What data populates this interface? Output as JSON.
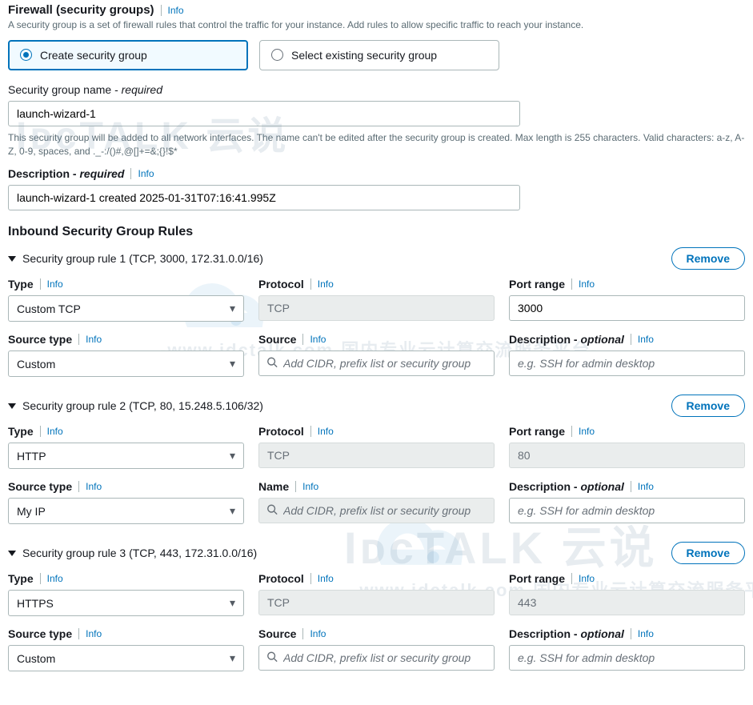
{
  "info_label": "Info",
  "firewall": {
    "title": "Firewall (security groups)",
    "subtext": "A security group is a set of firewall rules that control the traffic for your instance. Add rules to allow specific traffic to reach your instance.",
    "radio_create": "Create security group",
    "radio_select": "Select existing security group"
  },
  "sg_name": {
    "label": "Security group name - ",
    "req": "required",
    "value": "launch-wizard-1",
    "helper": "This security group will be added to all network interfaces. The name can't be edited after the security group is created. Max length is 255 characters. Valid characters: a-z, A-Z, 0-9, spaces, and ._-:/()#,@[]+=&;{}!$*"
  },
  "desc": {
    "label": "Description - ",
    "req": "required",
    "value": "launch-wizard-1 created 2025-01-31T07:16:41.995Z"
  },
  "inbound_heading": "Inbound Security Group Rules",
  "remove_label": "Remove",
  "labels": {
    "type": "Type",
    "protocol": "Protocol",
    "port_range": "Port range",
    "source_type": "Source type",
    "source": "Source",
    "name": "Name",
    "description_opt": "Description - ",
    "optional": "optional",
    "source_placeholder": "Add CIDR, prefix list or security group",
    "desc_placeholder": "e.g. SSH for admin desktop"
  },
  "rules": [
    {
      "title": "Security group rule 1 (TCP, 3000, 172.31.0.0/16)",
      "type": "Custom TCP",
      "protocol": "TCP",
      "port": "3000",
      "port_disabled": false,
      "source_type": "Custom",
      "source_label_key": "source",
      "source_disabled": false
    },
    {
      "title": "Security group rule 2 (TCP, 80, 15.248.5.106/32)",
      "type": "HTTP",
      "protocol": "TCP",
      "port": "80",
      "port_disabled": true,
      "source_type": "My IP",
      "source_label_key": "name",
      "source_disabled": true
    },
    {
      "title": "Security group rule 3 (TCP, 443, 172.31.0.0/16)",
      "type": "HTTPS",
      "protocol": "TCP",
      "port": "443",
      "port_disabled": true,
      "source_type": "Custom",
      "source_label_key": "source",
      "source_disabled": false
    }
  ],
  "watermarks": {
    "w1": "IᴅcTALK 云说",
    "w2": "-www.idctalk.com-国内专业云计算交流服务平台-",
    "w3": "IᴅcTALK 云说",
    "w4": "-www.idctalk.com-国内专业云计算交流服务平台-"
  }
}
